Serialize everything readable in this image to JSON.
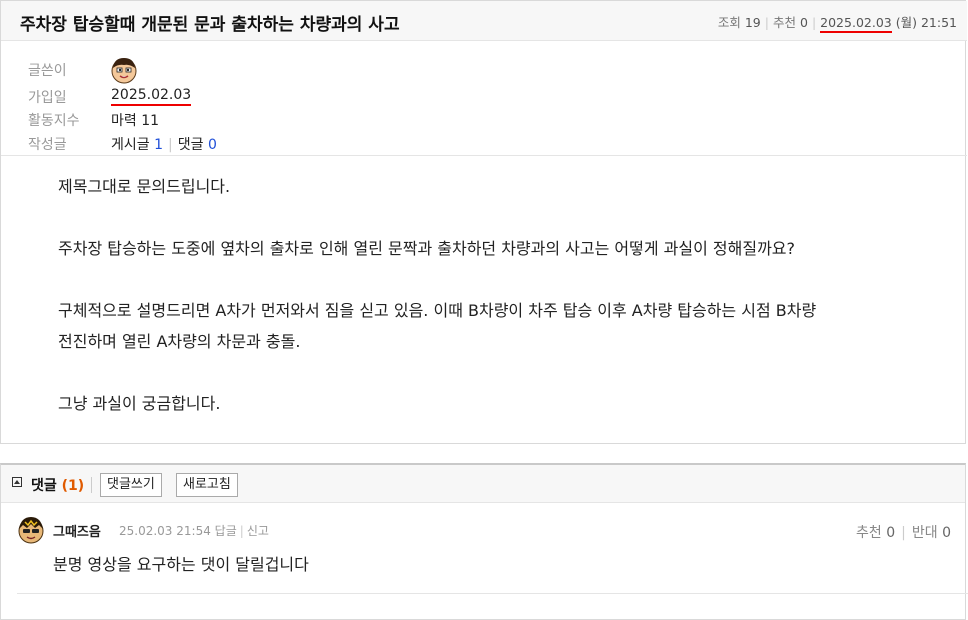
{
  "post": {
    "title": "주차장 탑승할때 개문된 문과 출차하는 차량과의 사고",
    "meta": {
      "views_label": "조회",
      "views": "19",
      "recommend_label": "추천",
      "recommend": "0",
      "date": "2025.02.03",
      "weekday": "(월)",
      "time": "21:51"
    },
    "author": {
      "writer_label": "글쓴이",
      "join_label": "가입일",
      "join_date": "2025.02.03",
      "activity_label": "활동지수",
      "activity_value": "마력 11",
      "written_label": "작성글",
      "posts_label": "게시글",
      "posts_count": "1",
      "comments_label": "댓글",
      "comments_count": "0"
    },
    "body": [
      "제목그대로 문의드립니다.",
      "주차장 탑승하는 도중에 옆차의 출차로 인해 열린 문짝과 출차하던 차량과의 사고는 어떻게 과실이 정해질까요?",
      "구체적으로 설명드리면 A차가 먼저와서 짐을 싣고 있음. 이때 B차량이 차주 탑승 이후 A차량 탑승하는 시점 B차량",
      "전진하며 열린 A차량의 차문과 충돌.",
      "그냥 과실이 궁금합니다."
    ]
  },
  "comments": {
    "header_label": "댓글",
    "count": "(1)",
    "write_button": "댓글쓰기",
    "refresh_button": "새로고침",
    "items": [
      {
        "nickname": "그때즈음",
        "time": "25.02.03 21:54",
        "reply": "답글",
        "report": "신고",
        "up_label": "추천",
        "up": "0",
        "down_label": "반대",
        "down": "0",
        "text": "분명 영상을 요구하는 댓이 달릴겁니다"
      }
    ]
  },
  "colors": {
    "accent_red": "#e00000",
    "link_blue": "#1f4fd8",
    "count_orange": "#e05a00"
  }
}
